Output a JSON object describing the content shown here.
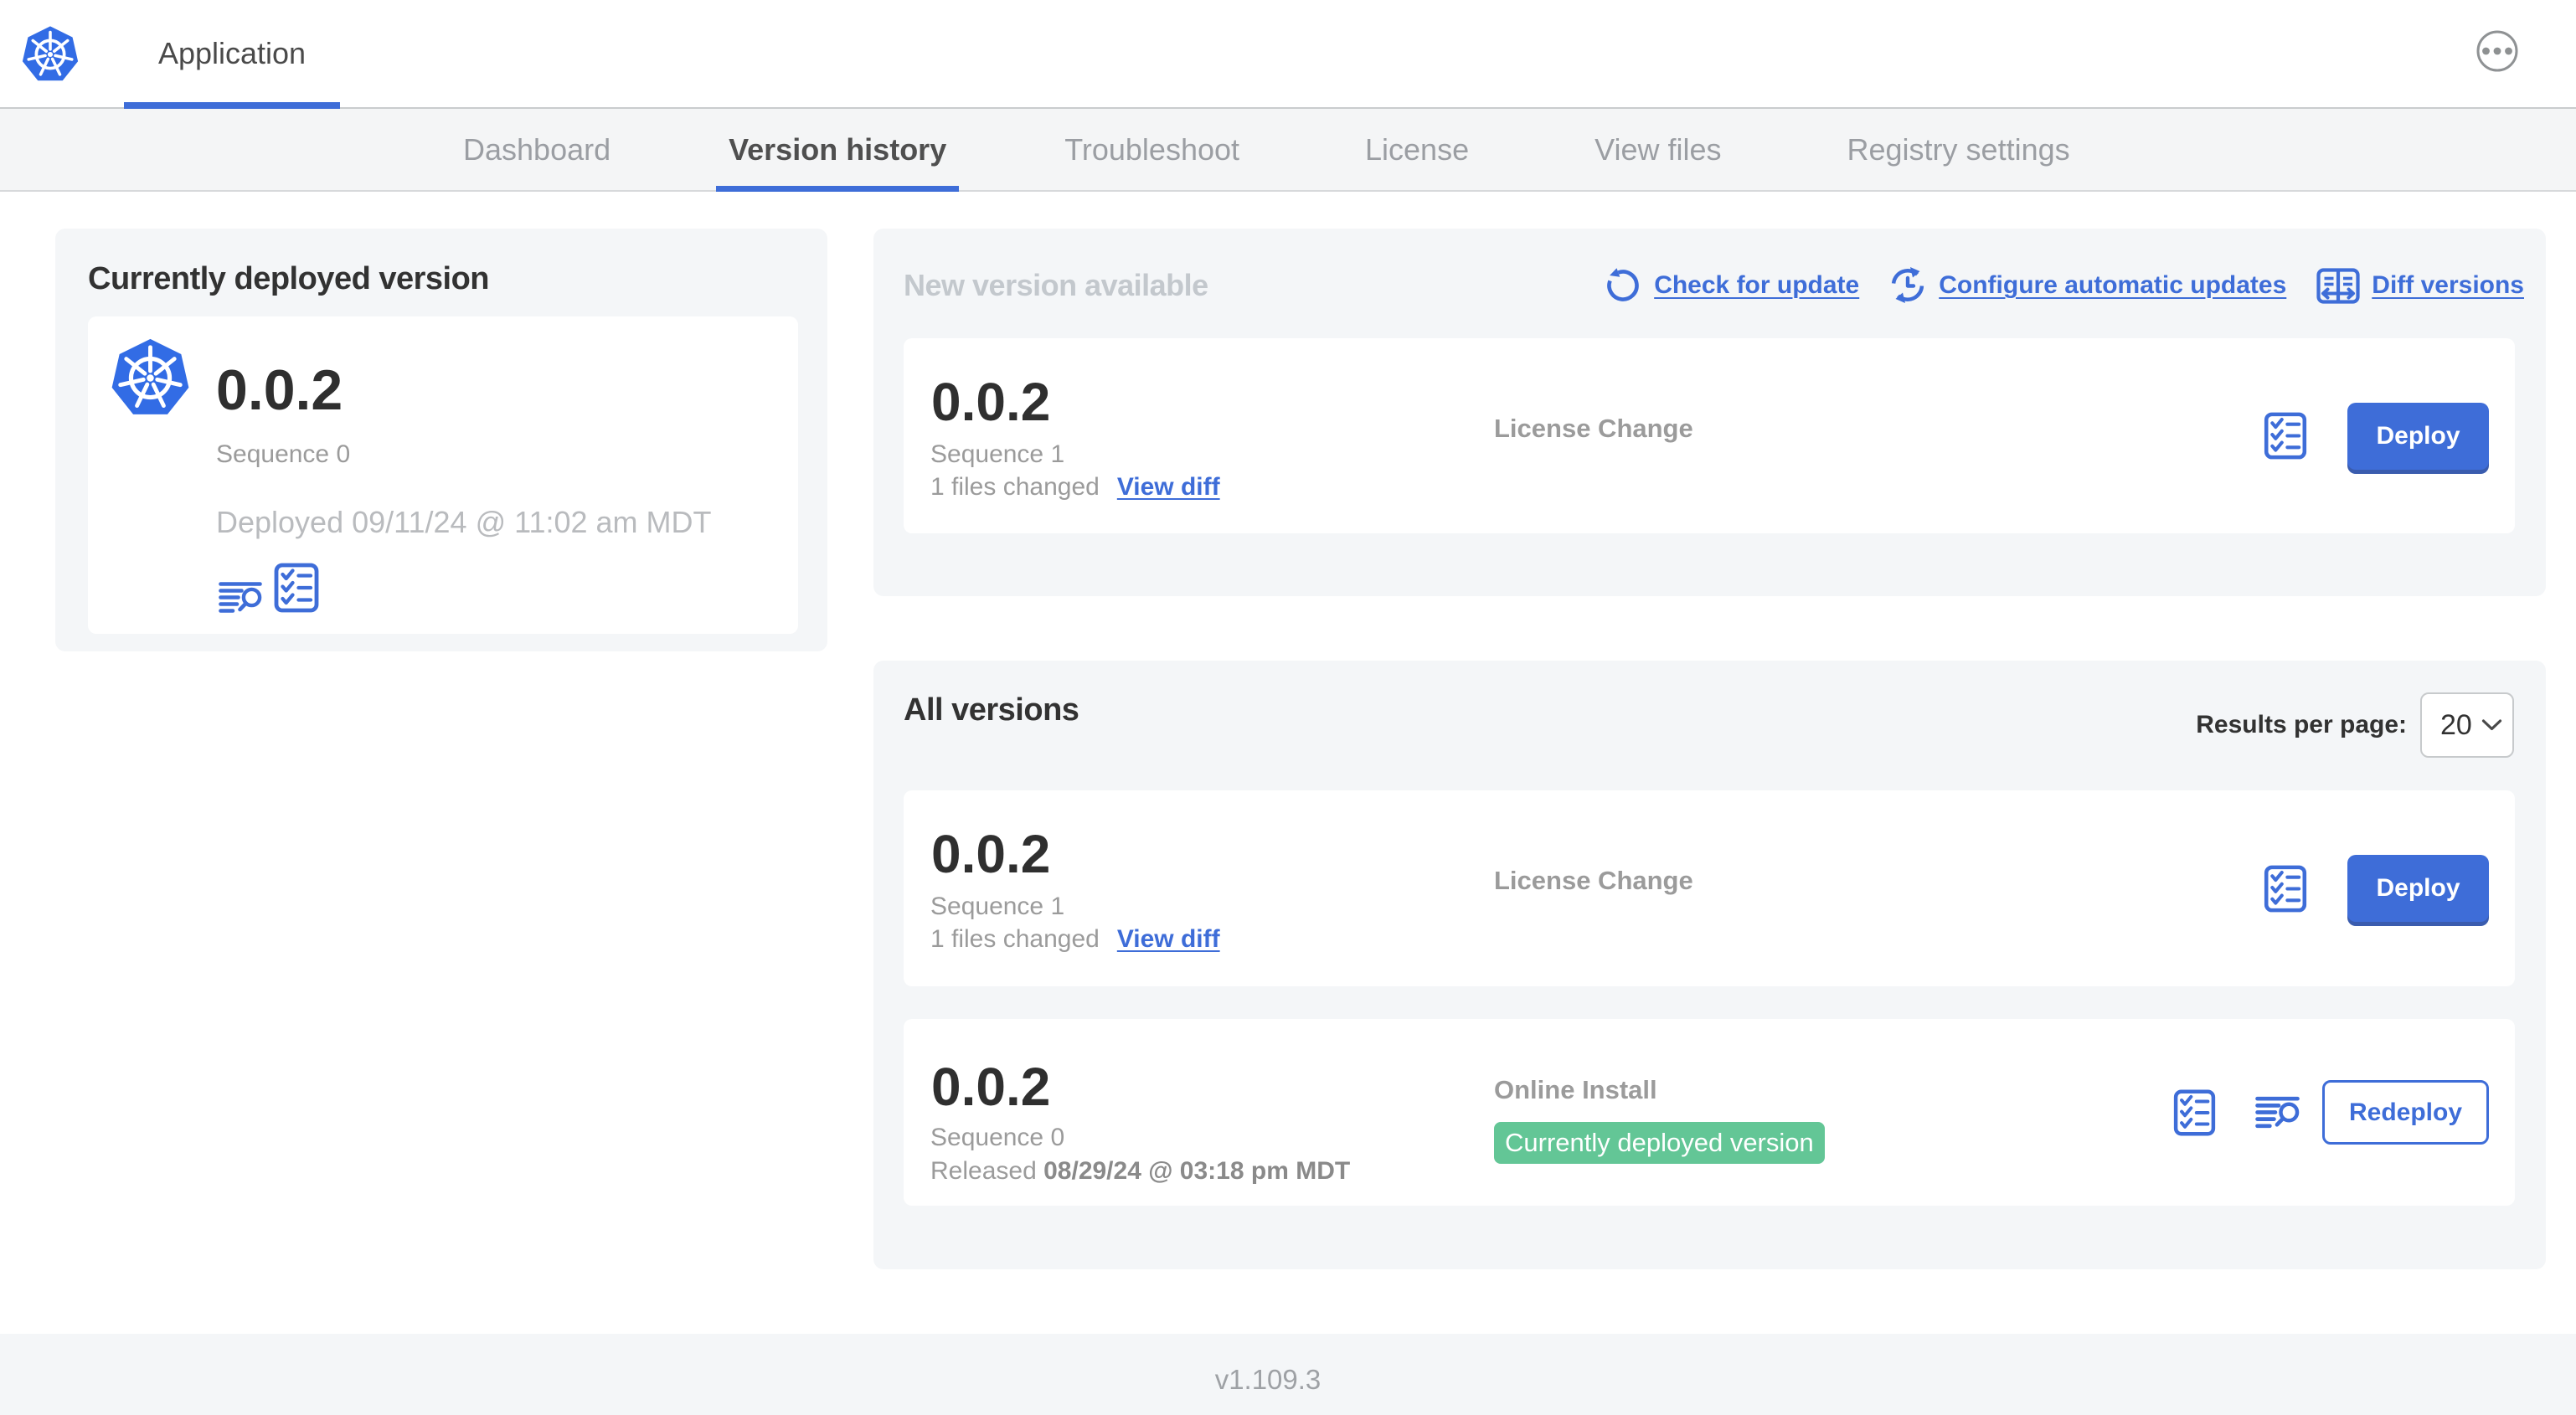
{
  "header": {
    "app_tab": "Application"
  },
  "nav": {
    "tabs": [
      "Dashboard",
      "Version history",
      "Troubleshoot",
      "License",
      "View files",
      "Registry settings"
    ],
    "active_tab": "Version history"
  },
  "deployed": {
    "title": "Currently deployed version",
    "version": "0.0.2",
    "sequence": "Sequence 0",
    "deployed_at": "Deployed 09/11/24 @ 11:02 am MDT"
  },
  "new_version": {
    "title": "New version available",
    "check_link": "Check for update",
    "configure_link": "Configure automatic updates",
    "diff_link": "Diff versions",
    "row": {
      "version": "0.0.2",
      "sequence": "Sequence 1",
      "files_changed": "1 files changed",
      "view_diff": "View diff",
      "status": "License Change",
      "button": "Deploy"
    }
  },
  "all_versions": {
    "title": "All versions",
    "results_label": "Results per page:",
    "results_value": "20",
    "rows": [
      {
        "version": "0.0.2",
        "sequence": "Sequence 1",
        "files_changed": "1 files changed",
        "view_diff": "View diff",
        "status": "License Change",
        "button": "Deploy"
      },
      {
        "version": "0.0.2",
        "sequence": "Sequence 0",
        "released_label": "Released",
        "released_date": "08/29/24 @ 03:18 pm MDT",
        "status": "Online Install",
        "badge": "Currently deployed version",
        "button": "Redeploy"
      }
    ]
  },
  "footer": {
    "version": "v1.109.3"
  },
  "icons": {
    "app_logo": "kubernetes-logo-icon",
    "more_options": "ellipsis-icon",
    "check_update": "refresh-icon",
    "configure_updates": "auto-update-clock-icon",
    "diff_versions": "diff-icon",
    "preflight_checks": "checklist-icon",
    "deploy_logs": "log-search-icon",
    "select_arrow": "chevron-down-icon"
  },
  "colors": {
    "primary_blue": "#3e6dd8",
    "k8s_blue": "#326ce5",
    "badge_green": "#63c696",
    "dark_text": "#323232",
    "gray_text": "#9b9b9b",
    "panel_bg": "#f4f6f8"
  }
}
